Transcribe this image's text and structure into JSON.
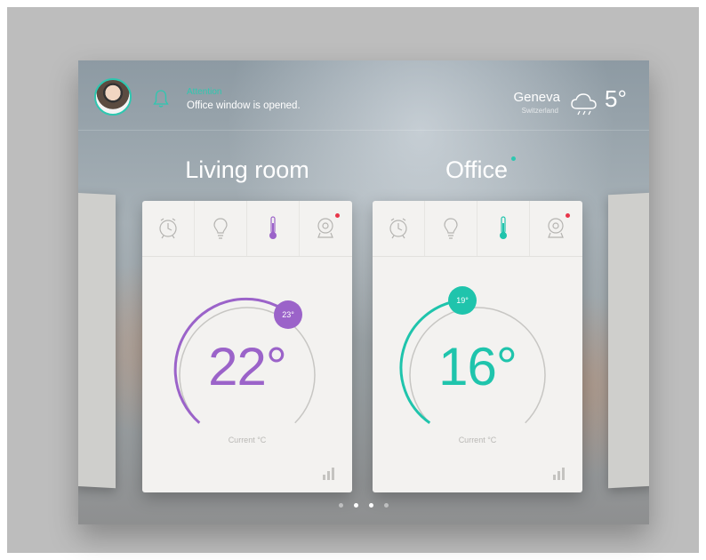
{
  "header": {
    "notification_title": "Attention",
    "notification_text": "Office window is opened.",
    "city": "Geneva",
    "city_sub": "Switzerland",
    "outdoor_temp": "5°"
  },
  "rooms": [
    {
      "title": "Living room",
      "current_temp": "22°",
      "setpoint": "23°",
      "current_label": "Current °C",
      "accent": "#9b63c9",
      "level": 0.78,
      "active_tab": "thermometer"
    },
    {
      "title": "Office",
      "current_temp": "16°",
      "setpoint": "19°",
      "current_label": "Current °C",
      "accent": "#1fc4ac",
      "level": 0.38,
      "active_tab": "thermometer"
    }
  ],
  "tabs": [
    "alarm-clock-icon",
    "bulb-icon",
    "thermometer-icon",
    "camera-icon"
  ],
  "pager": {
    "count": 4,
    "active": 1
  },
  "colors": {
    "teal": "#2ec7b0",
    "purple": "#9b63c9",
    "alert": "#e8364a"
  }
}
